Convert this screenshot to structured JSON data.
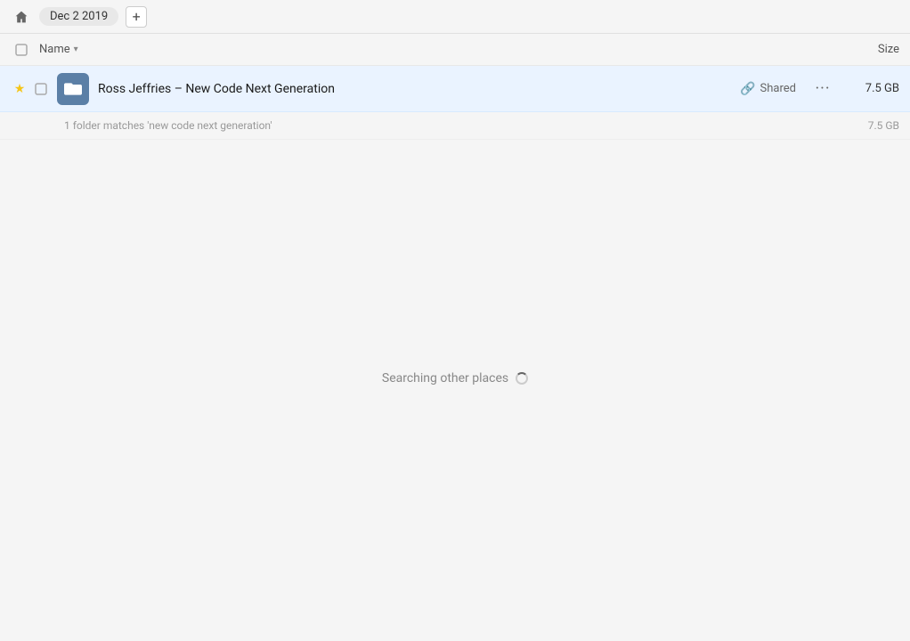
{
  "toolbar": {
    "date_label": "Dec 2 2019",
    "add_button_label": "+",
    "home_tooltip": "Home"
  },
  "columns": {
    "name_label": "Name",
    "size_label": "Size"
  },
  "file_row": {
    "name": "Ross Jeffries – New Code Next Generation",
    "shared_label": "Shared",
    "size": "7.5 GB",
    "match_text": "1 folder matches 'new code next generation'",
    "match_size": "7.5 GB"
  },
  "searching": {
    "label": "Searching other places"
  }
}
